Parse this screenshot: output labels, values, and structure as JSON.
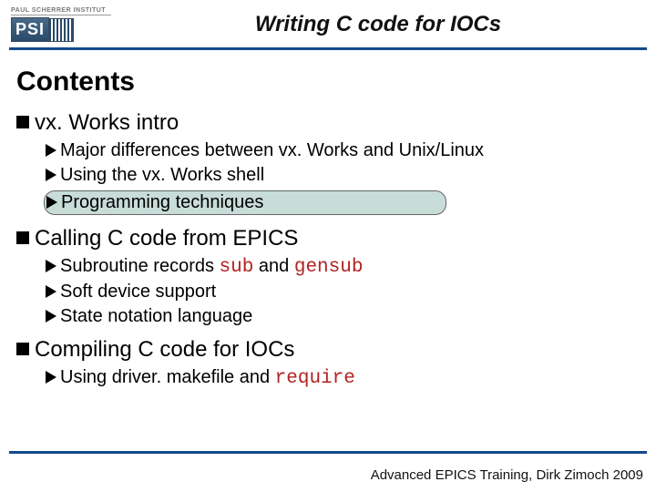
{
  "logo": {
    "institute": "PAUL SCHERRER INSTITUT",
    "abbrev": "PSI"
  },
  "title": "Writing C code for IOCs",
  "contents_heading": "Contents",
  "sections": [
    {
      "label": "vx. Works intro",
      "items": [
        {
          "text": "Major differences between vx. Works and Unix/Linux",
          "highlight": false
        },
        {
          "text": "Using the vx. Works shell",
          "highlight": false
        },
        {
          "text": "Programming techniques",
          "highlight": true
        }
      ]
    },
    {
      "label": "Calling C code from EPICS",
      "items": [
        {
          "text": "Subroutine records ",
          "code1": "sub",
          "mid": " and ",
          "code2": "gensub",
          "highlight": false
        },
        {
          "text": "Soft device support",
          "highlight": false
        },
        {
          "text": "State notation language",
          "highlight": false
        }
      ]
    },
    {
      "label": "Compiling C code for IOCs",
      "items": [
        {
          "text": "Using driver. makefile and ",
          "code1": "require",
          "highlight": false
        }
      ]
    }
  ],
  "footer": "Advanced EPICS Training, Dirk Zimoch 2009"
}
